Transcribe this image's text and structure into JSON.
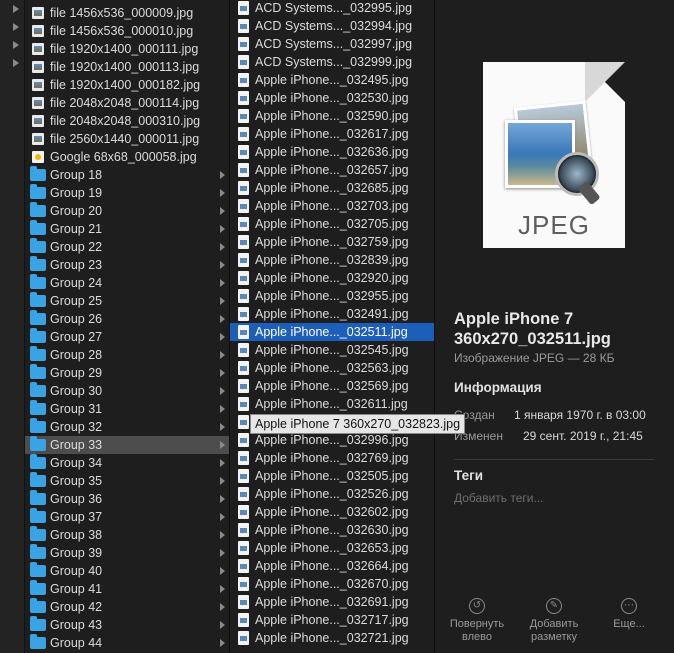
{
  "column0": {
    "arrows": 4
  },
  "column1": {
    "items": [
      {
        "type": "image",
        "label": "file 1456x536_000009.jpg"
      },
      {
        "type": "image",
        "label": "file 1456x536_000010.jpg"
      },
      {
        "type": "image",
        "label": "file 1920x1400_000111.jpg"
      },
      {
        "type": "image",
        "label": "file 1920x1400_000113.jpg"
      },
      {
        "type": "image",
        "label": "file 1920x1400_000182.jpg"
      },
      {
        "type": "image",
        "label": "file 2048x2048_000114.jpg"
      },
      {
        "type": "image",
        "label": "file 2048x2048_000310.jpg"
      },
      {
        "type": "image",
        "label": "file 2560x1440_000011.jpg"
      },
      {
        "type": "google",
        "label": "Google 68x68_000058.jpg"
      },
      {
        "type": "folder",
        "label": "Group 18"
      },
      {
        "type": "folder",
        "label": "Group 19"
      },
      {
        "type": "folder",
        "label": "Group 20"
      },
      {
        "type": "folder",
        "label": "Group 21"
      },
      {
        "type": "folder",
        "label": "Group 22"
      },
      {
        "type": "folder",
        "label": "Group 23"
      },
      {
        "type": "folder",
        "label": "Group 24"
      },
      {
        "type": "folder",
        "label": "Group 25"
      },
      {
        "type": "folder",
        "label": "Group 26"
      },
      {
        "type": "folder",
        "label": "Group 27"
      },
      {
        "type": "folder",
        "label": "Group 28"
      },
      {
        "type": "folder",
        "label": "Group 29"
      },
      {
        "type": "folder",
        "label": "Group 30"
      },
      {
        "type": "folder",
        "label": "Group 31"
      },
      {
        "type": "folder",
        "label": "Group 32"
      },
      {
        "type": "folder",
        "label": "Group 33",
        "highlighted": true
      },
      {
        "type": "folder",
        "label": "Group 34"
      },
      {
        "type": "folder",
        "label": "Group 35"
      },
      {
        "type": "folder",
        "label": "Group 36"
      },
      {
        "type": "folder",
        "label": "Group 37"
      },
      {
        "type": "folder",
        "label": "Group 38"
      },
      {
        "type": "folder",
        "label": "Group 39"
      },
      {
        "type": "folder",
        "label": "Group 40"
      },
      {
        "type": "folder",
        "label": "Group 41"
      },
      {
        "type": "folder",
        "label": "Group 42"
      },
      {
        "type": "folder",
        "label": "Group 43"
      },
      {
        "type": "folder",
        "label": "Group 44"
      }
    ]
  },
  "column2": {
    "items": [
      {
        "label": "ACD Systems..._032995.jpg"
      },
      {
        "label": "ACD Systems..._032994.jpg"
      },
      {
        "label": "ACD Systems..._032997.jpg"
      },
      {
        "label": "ACD Systems..._032999.jpg"
      },
      {
        "label": "Apple iPhone..._032495.jpg"
      },
      {
        "label": "Apple iPhone..._032530.jpg"
      },
      {
        "label": "Apple iPhone..._032590.jpg"
      },
      {
        "label": "Apple iPhone..._032617.jpg"
      },
      {
        "label": "Apple iPhone..._032636.jpg"
      },
      {
        "label": "Apple iPhone..._032657.jpg"
      },
      {
        "label": "Apple iPhone..._032685.jpg"
      },
      {
        "label": "Apple iPhone..._032703.jpg"
      },
      {
        "label": "Apple iPhone..._032705.jpg"
      },
      {
        "label": "Apple iPhone..._032759.jpg"
      },
      {
        "label": "Apple iPhone..._032839.jpg"
      },
      {
        "label": "Apple iPhone..._032920.jpg"
      },
      {
        "label": "Apple iPhone..._032955.jpg"
      },
      {
        "label": "Apple iPhone..._032491.jpg"
      },
      {
        "label": "Apple iPhone..._032511.jpg",
        "selected": true
      },
      {
        "label": "Apple iPhone..._032545.jpg"
      },
      {
        "label": "Apple iPhone..._032563.jpg"
      },
      {
        "label": "Apple iPhone..._032569.jpg"
      },
      {
        "label": "Apple iPhone..._032611.jpg"
      },
      {
        "label": "Apple iPhone..._032823.jpg",
        "hidden_by_tooltip": true
      },
      {
        "label": "Apple iPhone..._032996.jpg"
      },
      {
        "label": "Apple iPhone..._032769.jpg"
      },
      {
        "label": "Apple iPhone..._032505.jpg"
      },
      {
        "label": "Apple iPhone..._032526.jpg"
      },
      {
        "label": "Apple iPhone..._032602.jpg"
      },
      {
        "label": "Apple iPhone..._032630.jpg"
      },
      {
        "label": "Apple iPhone..._032653.jpg"
      },
      {
        "label": "Apple iPhone..._032664.jpg"
      },
      {
        "label": "Apple iPhone..._032670.jpg"
      },
      {
        "label": "Apple iPhone..._032691.jpg"
      },
      {
        "label": "Apple iPhone..._032717.jpg"
      },
      {
        "label": "Apple iPhone..._032721.jpg"
      }
    ],
    "tooltip": "Apple iPhone 7 360x270_032823.jpg"
  },
  "preview": {
    "thumb_text": "JPEG",
    "title": "Apple iPhone 7 360x270_032511.jpg",
    "subtitle": "Изображение JPEG — 28 КБ",
    "info_heading": "Информация",
    "created_key": "Создан",
    "created_val": "1 января 1970 г. в 03:00",
    "modified_key": "Изменен",
    "modified_val": "29 сент. 2019 г., 21:45",
    "tags_heading": "Теги",
    "tags_placeholder": "Добавить теги...",
    "actions": [
      {
        "icon": "rotate-left-icon",
        "glyph": "↺",
        "label_1": "Повернуть",
        "label_2": "влево"
      },
      {
        "icon": "markup-icon",
        "glyph": "✎",
        "label_1": "Добавить",
        "label_2": "разметку"
      },
      {
        "icon": "more-icon",
        "glyph": "⋯",
        "label_1": "Еще...",
        "label_2": ""
      }
    ]
  },
  "colors": {
    "selection": "#1d5fb8",
    "folder": "#3aa3e3",
    "highlight": "#4d4d4d"
  }
}
